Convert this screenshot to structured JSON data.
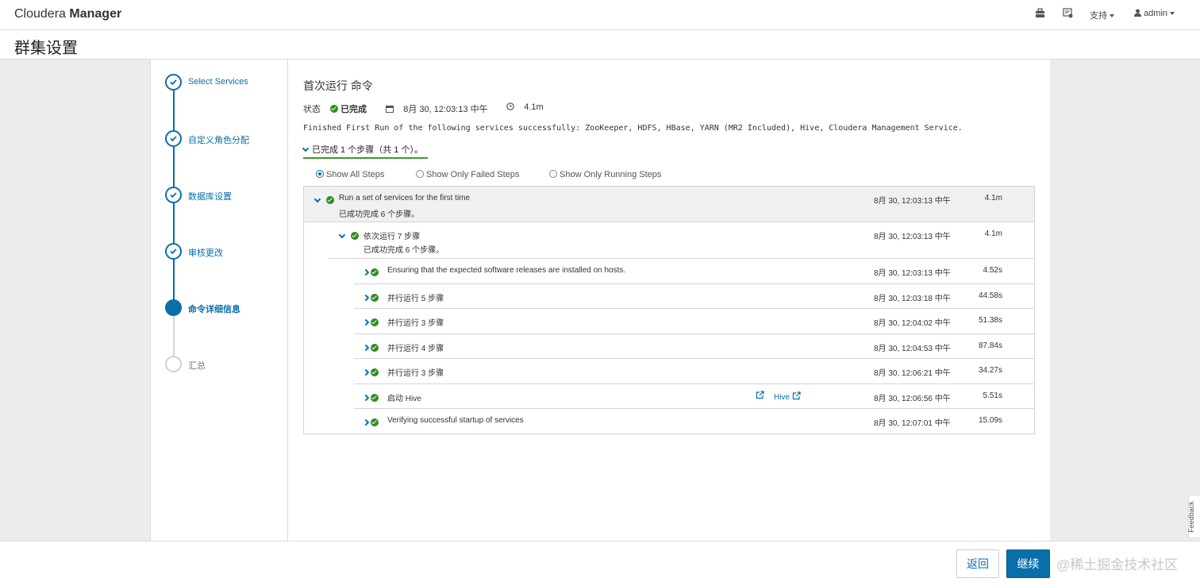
{
  "app": {
    "brand_light": "Cloudera",
    "brand_bold": "Manager",
    "nav": {
      "support_label": "支持",
      "user_label": "admin"
    }
  },
  "page": {
    "title": "群集设置"
  },
  "wizard": {
    "steps": [
      {
        "label": "Select Services",
        "state": "done"
      },
      {
        "label": "自定义角色分配",
        "state": "done"
      },
      {
        "label": "数据库设置",
        "state": "done"
      },
      {
        "label": "审核更改",
        "state": "done"
      },
      {
        "label": "命令详细信息",
        "state": "active"
      },
      {
        "label": "汇总",
        "state": "todo"
      }
    ]
  },
  "command": {
    "title": "首次运行 命令",
    "status_label": "状态",
    "status_value": "已完成",
    "date": "8月 30, 12:03:13 中午",
    "duration": "4.1m",
    "message": "Finished First Run of the following services successfully: ZooKeeper, HDFS, HBase, YARN (MR2 Included), Hive, Cloudera Management Service.",
    "summary": "已完成 1 个步骤（共 1 个）。"
  },
  "filters": {
    "all": "Show All Steps",
    "failed": "Show Only Failed Steps",
    "running": "Show Only Running Steps",
    "selected": "all"
  },
  "steps": {
    "top": {
      "name": "Run a set of services for the first time",
      "sub": "已成功完成  6  个步骤。",
      "time": "8月 30, 12:03:13 中午",
      "duration": "4.1m"
    },
    "group": {
      "name": "依次运行 7 步骤",
      "sub": "已成功完成  6  个步骤。",
      "time": "8月 30, 12:03:13 中午",
      "duration": "4.1m"
    },
    "items": [
      {
        "name": "Ensuring that the expected software releases are installed on hosts.",
        "time": "8月 30, 12:03:13 中午",
        "duration": "4.52s"
      },
      {
        "name": "并行运行 5 步骤",
        "time": "8月 30, 12:03:18 中午",
        "duration": "44.58s"
      },
      {
        "name": "并行运行 3 步骤",
        "time": "8月 30, 12:04:02 中午",
        "duration": "51.38s"
      },
      {
        "name": "并行运行 4 步骤",
        "time": "8月 30, 12:04:53 中午",
        "duration": "87.84s"
      },
      {
        "name": "并行运行 3 步骤",
        "time": "8月 30, 12:06:21 中午",
        "duration": "34.27s"
      },
      {
        "name": "启动 Hive",
        "time": "8月 30, 12:06:56 中午",
        "duration": "5.51s",
        "link": "Hive"
      },
      {
        "name": "Verifying successful startup of services",
        "time": "8月 30, 12:07:01 中午",
        "duration": "15.09s"
      }
    ]
  },
  "footer": {
    "back_label": "返回",
    "next_label": "继续",
    "watermark": "@稀土掘金技术社区"
  },
  "feedback_label": "Feedback",
  "colors": {
    "accent": "#0a6ea8",
    "success": "#2e8b1e"
  }
}
